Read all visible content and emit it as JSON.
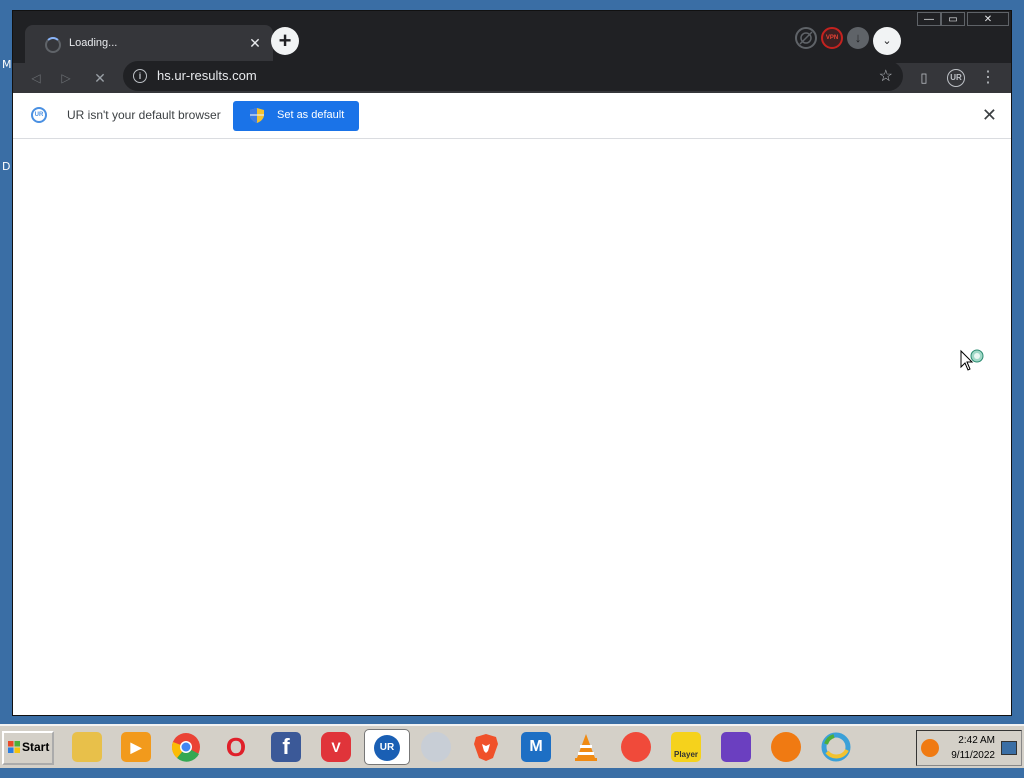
{
  "desktop": {
    "left_labels": [
      "M",
      "D"
    ]
  },
  "browser": {
    "tab": {
      "title": "Loading...",
      "close": "✕"
    },
    "new_tab": "+",
    "tab_dropdown": "⌄",
    "extensions": [
      {
        "name": "crossed-globe",
        "label": ""
      },
      {
        "name": "vpn-badge",
        "label": "VPN"
      },
      {
        "name": "download",
        "label": "↓"
      }
    ],
    "window_controls": {
      "minimize": "—",
      "maximize": "▭",
      "close": "✕"
    },
    "toolbar": {
      "back": "◁",
      "forward": "▷",
      "stop": "✕",
      "url": "hs.ur-results.com",
      "info": "i",
      "star": "☆",
      "sidepanel": "▯",
      "profile": "UR",
      "menu": "⋮"
    },
    "infobar": {
      "message": "UR isn't your default browser",
      "button": "Set as default",
      "close": "✕",
      "logo": "UR"
    }
  },
  "taskbar": {
    "start_label": "Start",
    "apps": [
      {
        "name": "file-manager",
        "glyph": "",
        "color": "#e8c04a"
      },
      {
        "name": "media-player",
        "glyph": "▶",
        "color": "#f29a1c"
      },
      {
        "name": "chrome",
        "glyph": "",
        "color": "#34a853"
      },
      {
        "name": "opera",
        "glyph": "O",
        "color": "#e0202a"
      },
      {
        "name": "facebook",
        "glyph": "f",
        "color": "#3b5998"
      },
      {
        "name": "vivaldi",
        "glyph": "V",
        "color": "#e0343a"
      },
      {
        "name": "ur-browser",
        "glyph": "UR",
        "color": "#1a5fb4"
      },
      {
        "name": "gray-sphere",
        "glyph": "",
        "color": "#c8ced6"
      },
      {
        "name": "brave",
        "glyph": "",
        "color": "#f0512a"
      },
      {
        "name": "maxthon",
        "glyph": "M",
        "color": "#1d6fc4"
      },
      {
        "name": "vlc",
        "glyph": "",
        "color": "#f08a12"
      },
      {
        "name": "gom",
        "glyph": "",
        "color": "#f04a3a"
      },
      {
        "name": "kmplayer",
        "glyph": "Player",
        "color": "#f5d21c"
      },
      {
        "name": "visual-studio",
        "glyph": "",
        "color": "#6b3fc0"
      },
      {
        "name": "avast-browser",
        "glyph": "",
        "color": "#f07a12"
      },
      {
        "name": "edge-legacy",
        "glyph": "",
        "color": "#3aa0d8"
      }
    ],
    "clock": {
      "time": "2:42 AM",
      "date": "9/11/2022"
    }
  }
}
